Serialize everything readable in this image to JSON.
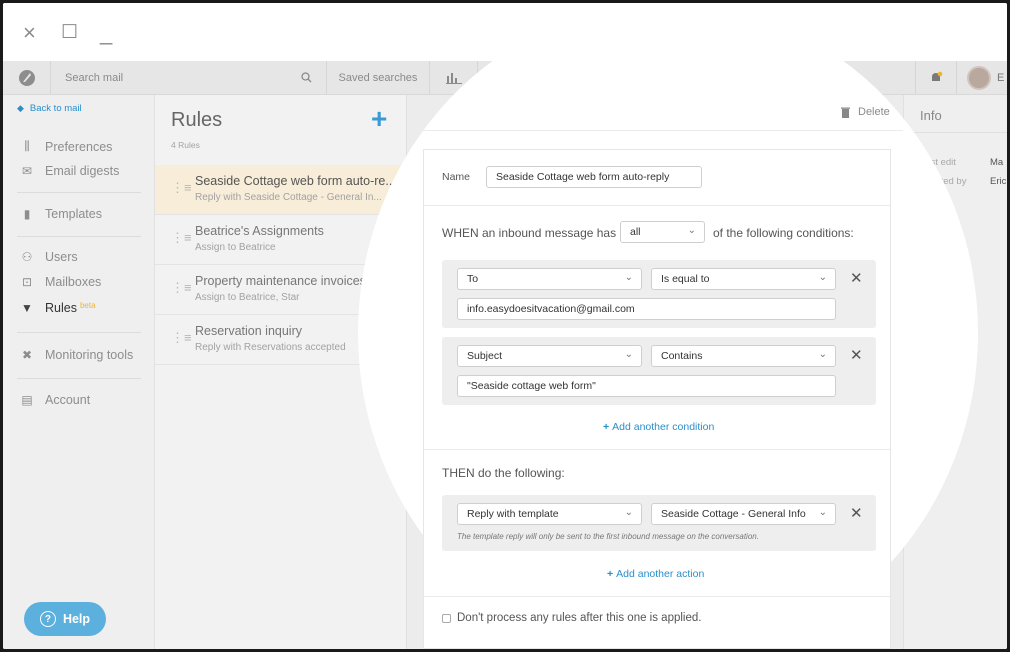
{
  "window": {
    "close_icon": "×",
    "maximize_icon": "☐",
    "minimize_icon": "_"
  },
  "topbar": {
    "search_placeholder": "Search mail",
    "search_icon": "⚲",
    "saved_searches": "Saved searches",
    "user_initial": "E"
  },
  "sidebar": {
    "back": "Back to mail",
    "items": [
      {
        "label": "Preferences",
        "icon": "sliders-icon"
      },
      {
        "label": "Email digests",
        "icon": "envelope-icon"
      },
      {
        "label": "Templates",
        "icon": "template-icon"
      },
      {
        "label": "Users",
        "icon": "users-icon"
      },
      {
        "label": "Mailboxes",
        "icon": "mailbox-icon"
      },
      {
        "label": "Rules",
        "icon": "filter-icon",
        "badge": "beta"
      },
      {
        "label": "Monitoring tools",
        "icon": "tools-icon"
      },
      {
        "label": "Account",
        "icon": "account-icon"
      }
    ],
    "help": "Help"
  },
  "rules": {
    "title": "Rules",
    "count": "4 Rules",
    "items": [
      {
        "title": "Seaside Cottage web form auto-re...",
        "subtitle": "Reply with Seaside Cottage - General In..."
      },
      {
        "title": "Beatrice's Assignments",
        "subtitle": "Assign to Beatrice"
      },
      {
        "title": "Property maintenance invoices",
        "subtitle": "Assign to Beatrice, Star"
      },
      {
        "title": "Reservation inquiry",
        "subtitle": "Reply with Reservations accepted"
      }
    ]
  },
  "editor": {
    "delete": "Delete",
    "name_label": "Name",
    "name_value": "Seaside Cottage web form auto-reply",
    "when_prefix": "WHEN an inbound message has",
    "match_value": "all",
    "when_suffix": "of the following conditions:",
    "conditions": [
      {
        "field": "To",
        "operator": "Is equal to",
        "value": "info.easydoesitvacation@gmail.com"
      },
      {
        "field": "Subject",
        "operator": "Contains",
        "value": "\"Seaside cottage web form\""
      }
    ],
    "add_condition": "Add another condition",
    "then_label": "THEN do the following:",
    "action": {
      "type": "Reply with template",
      "template": "Seaside Cottage - General Info",
      "note": "The template reply will only be sent to the first inbound message on the conversation."
    },
    "add_action": "Add another action",
    "stop_processing": "Don't process any rules after this one is applied."
  },
  "info": {
    "title": "Info",
    "rows": [
      {
        "label": "Last edit",
        "value": "Ma"
      },
      {
        "label": "Created by",
        "value": "Eric"
      }
    ]
  },
  "colors": {
    "accent": "#2a8fc9",
    "selected_row": "#f8edd9",
    "help": "#5bb0dd",
    "beta": "#f0b429"
  }
}
